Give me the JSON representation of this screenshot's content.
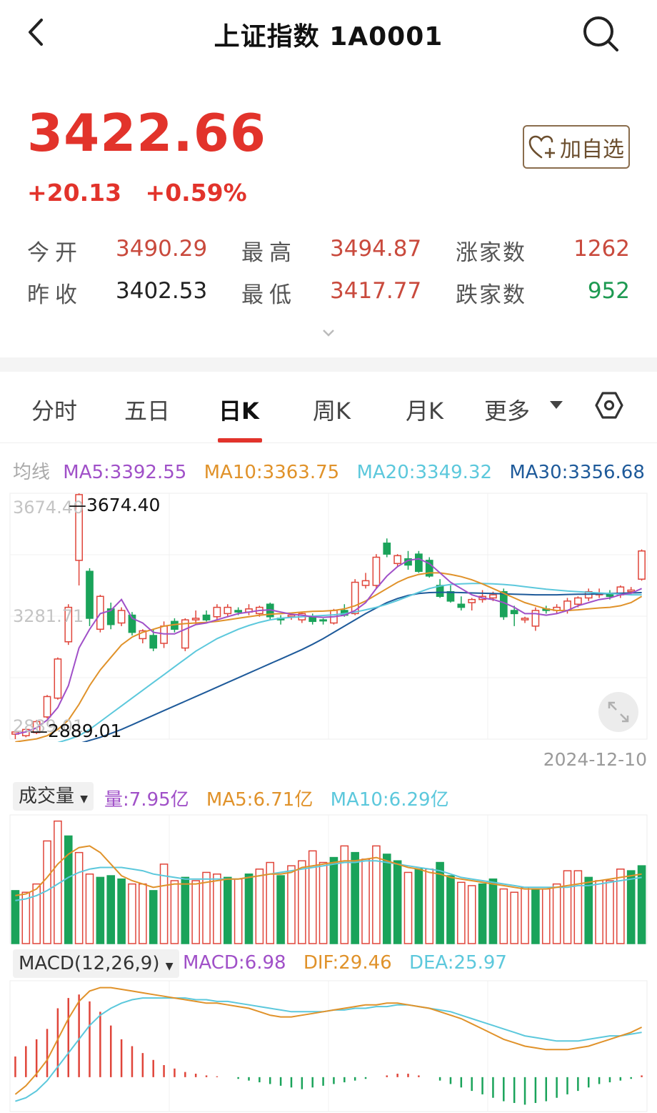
{
  "header": {
    "title": "上证指数 1A0001"
  },
  "quote": {
    "price": "3422.66",
    "change": "+20.13",
    "change_pct": "+0.59%",
    "fav_label": "加自选"
  },
  "stats": {
    "open_label": "今开",
    "open": "3490.29",
    "high_label": "最高",
    "high": "3494.87",
    "up_label": "涨家数",
    "up": "1262",
    "prev_close_label": "昨收",
    "prev_close": "3402.53",
    "low_label": "最低",
    "low": "3417.77",
    "down_label": "跌家数",
    "down": "952"
  },
  "tabs": [
    {
      "label": "分时"
    },
    {
      "label": "五日"
    },
    {
      "label": "日K"
    },
    {
      "label": "周K"
    },
    {
      "label": "月K"
    },
    {
      "label": "更多"
    }
  ],
  "ma_legend": {
    "title": "均线",
    "ma5": "MA5:3392.55",
    "ma10": "MA10:3363.75",
    "ma20": "MA20:3349.32",
    "ma30": "MA30:3356.68"
  },
  "kline": {
    "axis_top": "3674.40",
    "axis_mid": "3281.71",
    "axis_bottom": "2889.01",
    "max_marker": "3674.40",
    "min_marker": "2889.01",
    "end_date": "2024-12-10"
  },
  "volume": {
    "selector": "成交量",
    "vol": "量:7.95亿",
    "ma5": "MA5:6.71亿",
    "ma10": "MA10:6.29亿"
  },
  "macd": {
    "selector": "MACD(12,26,9)",
    "macd": "MACD:6.98",
    "dif": "DIF:29.46",
    "dea": "DEA:25.97"
  },
  "colors": {
    "up": "#e0453a",
    "down": "#1aa35a",
    "ma5": "#a050c8",
    "ma10": "#e0922a",
    "ma20": "#5cc8dc",
    "ma30": "#1e5a9a",
    "accent": "#e2332b"
  },
  "chart_data": [
    {
      "type": "candlestick",
      "title": "",
      "ylim": [
        2889.01,
        3674.4
      ],
      "y_ticks": [
        "3674.40",
        "3281.71",
        "2889.01"
      ],
      "x_end": "2024-12-10",
      "candles": [
        {
          "o": 2905,
          "h": 2915,
          "l": 2889,
          "c": 2912
        },
        {
          "o": 2900,
          "h": 2925,
          "l": 2895,
          "c": 2920
        },
        {
          "o": 2910,
          "h": 2950,
          "l": 2905,
          "c": 2945
        },
        {
          "o": 2960,
          "h": 3030,
          "l": 2955,
          "c": 3025
        },
        {
          "o": 3020,
          "h": 3150,
          "l": 3015,
          "c": 3145
        },
        {
          "o": 3200,
          "h": 3320,
          "l": 3190,
          "c": 3310
        },
        {
          "o": 3460,
          "h": 3674,
          "l": 3380,
          "c": 3670
        },
        {
          "o": 3425,
          "h": 3435,
          "l": 3250,
          "c": 3275
        },
        {
          "o": 3240,
          "h": 3350,
          "l": 3230,
          "c": 3345
        },
        {
          "o": 3305,
          "h": 3325,
          "l": 3240,
          "c": 3255
        },
        {
          "o": 3260,
          "h": 3310,
          "l": 3250,
          "c": 3300
        },
        {
          "o": 3285,
          "h": 3295,
          "l": 3220,
          "c": 3230
        },
        {
          "o": 3210,
          "h": 3240,
          "l": 3195,
          "c": 3235
        },
        {
          "o": 3220,
          "h": 3240,
          "l": 3170,
          "c": 3180
        },
        {
          "o": 3195,
          "h": 3265,
          "l": 3180,
          "c": 3250
        },
        {
          "o": 3265,
          "h": 3275,
          "l": 3230,
          "c": 3240
        },
        {
          "o": 3180,
          "h": 3275,
          "l": 3170,
          "c": 3270
        },
        {
          "o": 3270,
          "h": 3300,
          "l": 3255,
          "c": 3275
        },
        {
          "o": 3285,
          "h": 3300,
          "l": 3265,
          "c": 3270
        },
        {
          "o": 3280,
          "h": 3320,
          "l": 3270,
          "c": 3310
        },
        {
          "o": 3290,
          "h": 3320,
          "l": 3280,
          "c": 3310
        },
        {
          "o": 3300,
          "h": 3310,
          "l": 3285,
          "c": 3295
        },
        {
          "o": 3295,
          "h": 3320,
          "l": 3285,
          "c": 3305
        },
        {
          "o": 3290,
          "h": 3315,
          "l": 3280,
          "c": 3310
        },
        {
          "o": 3320,
          "h": 3325,
          "l": 3270,
          "c": 3280
        },
        {
          "o": 3275,
          "h": 3285,
          "l": 3255,
          "c": 3270
        },
        {
          "o": 3280,
          "h": 3290,
          "l": 3270,
          "c": 3285
        },
        {
          "o": 3270,
          "h": 3295,
          "l": 3260,
          "c": 3290
        },
        {
          "o": 3280,
          "h": 3290,
          "l": 3255,
          "c": 3265
        },
        {
          "o": 3270,
          "h": 3275,
          "l": 3255,
          "c": 3268
        },
        {
          "o": 3260,
          "h": 3305,
          "l": 3255,
          "c": 3300
        },
        {
          "o": 3300,
          "h": 3320,
          "l": 3280,
          "c": 3285
        },
        {
          "o": 3290,
          "h": 3400,
          "l": 3285,
          "c": 3390
        },
        {
          "o": 3380,
          "h": 3420,
          "l": 3370,
          "c": 3395
        },
        {
          "o": 3380,
          "h": 3480,
          "l": 3370,
          "c": 3470
        },
        {
          "o": 3515,
          "h": 3530,
          "l": 3470,
          "c": 3480
        },
        {
          "o": 3450,
          "h": 3480,
          "l": 3440,
          "c": 3475
        },
        {
          "o": 3465,
          "h": 3490,
          "l": 3430,
          "c": 3445
        },
        {
          "o": 3480,
          "h": 3490,
          "l": 3420,
          "c": 3425
        },
        {
          "o": 3460,
          "h": 3470,
          "l": 3405,
          "c": 3410
        },
        {
          "o": 3380,
          "h": 3400,
          "l": 3340,
          "c": 3345
        },
        {
          "o": 3360,
          "h": 3380,
          "l": 3325,
          "c": 3330
        },
        {
          "o": 3320,
          "h": 3345,
          "l": 3300,
          "c": 3310
        },
        {
          "o": 3325,
          "h": 3340,
          "l": 3300,
          "c": 3335
        },
        {
          "o": 3335,
          "h": 3365,
          "l": 3325,
          "c": 3345
        },
        {
          "o": 3340,
          "h": 3360,
          "l": 3330,
          "c": 3350
        },
        {
          "o": 3360,
          "h": 3370,
          "l": 3270,
          "c": 3280
        },
        {
          "o": 3300,
          "h": 3315,
          "l": 3250,
          "c": 3290
        },
        {
          "o": 3270,
          "h": 3280,
          "l": 3260,
          "c": 3275
        },
        {
          "o": 3250,
          "h": 3310,
          "l": 3235,
          "c": 3300
        },
        {
          "o": 3305,
          "h": 3315,
          "l": 3290,
          "c": 3300
        },
        {
          "o": 3300,
          "h": 3320,
          "l": 3290,
          "c": 3310
        },
        {
          "o": 3300,
          "h": 3340,
          "l": 3290,
          "c": 3330
        },
        {
          "o": 3320,
          "h": 3345,
          "l": 3310,
          "c": 3340
        },
        {
          "o": 3340,
          "h": 3370,
          "l": 3330,
          "c": 3360
        },
        {
          "o": 3350,
          "h": 3370,
          "l": 3340,
          "c": 3355
        },
        {
          "o": 3355,
          "h": 3365,
          "l": 3335,
          "c": 3345
        },
        {
          "o": 3350,
          "h": 3380,
          "l": 3340,
          "c": 3375
        },
        {
          "o": 3360,
          "h": 3375,
          "l": 3350,
          "c": 3365
        },
        {
          "o": 3400,
          "h": 3495,
          "l": 3395,
          "c": 3490
        }
      ],
      "ma5": [
        2905,
        2912,
        2925,
        2950,
        2990,
        3060,
        3180,
        3240,
        3290,
        3300,
        3335,
        3275,
        3260,
        3230,
        3225,
        3225,
        3240,
        3255,
        3260,
        3270,
        3280,
        3290,
        3295,
        3300,
        3302,
        3295,
        3288,
        3285,
        3280,
        3278,
        3280,
        3285,
        3300,
        3325,
        3370,
        3410,
        3440,
        3460,
        3465,
        3450,
        3420,
        3390,
        3370,
        3350,
        3340,
        3335,
        3325,
        3310,
        3290,
        3290,
        3285,
        3290,
        3300,
        3315,
        3325,
        3335,
        3340,
        3350,
        3355,
        3370
      ],
      "ma10": [
        2880,
        2885,
        2890,
        2900,
        2920,
        2950,
        3000,
        3060,
        3110,
        3150,
        3190,
        3215,
        3230,
        3240,
        3250,
        3255,
        3258,
        3260,
        3262,
        3265,
        3270,
        3275,
        3280,
        3285,
        3288,
        3290,
        3292,
        3295,
        3297,
        3298,
        3300,
        3305,
        3315,
        3330,
        3350,
        3370,
        3390,
        3405,
        3415,
        3420,
        3420,
        3415,
        3408,
        3398,
        3385,
        3370,
        3355,
        3340,
        3325,
        3315,
        3305,
        3300,
        3300,
        3302,
        3305,
        3308,
        3310,
        3315,
        3325,
        3345
      ],
      "ma20": [
        2860,
        2862,
        2865,
        2870,
        2878,
        2888,
        2900,
        2920,
        2945,
        2970,
        2995,
        3020,
        3045,
        3070,
        3095,
        3120,
        3145,
        3170,
        3190,
        3210,
        3225,
        3240,
        3252,
        3262,
        3270,
        3275,
        3278,
        3280,
        3282,
        3284,
        3286,
        3290,
        3295,
        3302,
        3310,
        3320,
        3332,
        3345,
        3358,
        3370,
        3378,
        3383,
        3385,
        3386,
        3386,
        3385,
        3383,
        3380,
        3376,
        3372,
        3368,
        3365,
        3362,
        3360,
        3358,
        3356,
        3354,
        3352,
        3350,
        3350
      ],
      "ma30": [
        2850,
        2852,
        2855,
        2858,
        2862,
        2868,
        2875,
        2885,
        2895,
        2907,
        2920,
        2935,
        2950,
        2965,
        2980,
        2995,
        3010,
        3025,
        3040,
        3055,
        3070,
        3085,
        3100,
        3115,
        3130,
        3145,
        3160,
        3175,
        3192,
        3210,
        3230,
        3250,
        3270,
        3290,
        3308,
        3325,
        3338,
        3348,
        3354,
        3357,
        3358,
        3358,
        3357,
        3356,
        3355,
        3354,
        3353,
        3352,
        3351,
        3350,
        3350,
        3350,
        3351,
        3352,
        3352,
        3353,
        3354,
        3355,
        3356,
        3357
      ]
    },
    {
      "type": "bar",
      "title": "",
      "bars": [
        {
          "v": 3.2,
          "up": false
        },
        {
          "v": 3.1,
          "up": true
        },
        {
          "v": 3.6,
          "up": true
        },
        {
          "v": 6.2,
          "up": true
        },
        {
          "v": 7.4,
          "up": true
        },
        {
          "v": 6.5,
          "up": false
        },
        {
          "v": 5.5,
          "up": true
        },
        {
          "v": 4.2,
          "up": true
        },
        {
          "v": 4.0,
          "up": false
        },
        {
          "v": 4.1,
          "up": false
        },
        {
          "v": 3.9,
          "up": false
        },
        {
          "v": 3.6,
          "up": true
        },
        {
          "v": 3.6,
          "up": true
        },
        {
          "v": 3.2,
          "up": false
        },
        {
          "v": 4.8,
          "up": true
        },
        {
          "v": 3.8,
          "up": true
        },
        {
          "v": 4.0,
          "up": false
        },
        {
          "v": 3.8,
          "up": true
        },
        {
          "v": 4.3,
          "up": true
        },
        {
          "v": 4.2,
          "up": true
        },
        {
          "v": 4.0,
          "up": false
        },
        {
          "v": 3.9,
          "up": true
        },
        {
          "v": 4.2,
          "up": false
        },
        {
          "v": 4.5,
          "up": true
        },
        {
          "v": 4.9,
          "up": true
        },
        {
          "v": 4.1,
          "up": false
        },
        {
          "v": 4.7,
          "up": true
        },
        {
          "v": 5.0,
          "up": true
        },
        {
          "v": 5.6,
          "up": true
        },
        {
          "v": 4.9,
          "up": true
        },
        {
          "v": 5.2,
          "up": false
        },
        {
          "v": 5.9,
          "up": true
        },
        {
          "v": 5.5,
          "up": false
        },
        {
          "v": 5.1,
          "up": true
        },
        {
          "v": 5.9,
          "up": true
        },
        {
          "v": 5.4,
          "up": false
        },
        {
          "v": 5.0,
          "up": false
        },
        {
          "v": 4.3,
          "up": true
        },
        {
          "v": 4.5,
          "up": false
        },
        {
          "v": 4.5,
          "up": true
        },
        {
          "v": 4.9,
          "up": false
        },
        {
          "v": 4.1,
          "up": false
        },
        {
          "v": 3.7,
          "up": true
        },
        {
          "v": 3.5,
          "up": true
        },
        {
          "v": 3.6,
          "up": false
        },
        {
          "v": 3.9,
          "up": false
        },
        {
          "v": 3.3,
          "up": true
        },
        {
          "v": 3.1,
          "up": true
        },
        {
          "v": 3.4,
          "up": true
        },
        {
          "v": 3.3,
          "up": false
        },
        {
          "v": 3.3,
          "up": true
        },
        {
          "v": 3.6,
          "up": true
        },
        {
          "v": 4.4,
          "up": true
        },
        {
          "v": 4.4,
          "up": true
        },
        {
          "v": 4.0,
          "up": false
        },
        {
          "v": 3.8,
          "up": true
        },
        {
          "v": 3.8,
          "up": true
        },
        {
          "v": 4.5,
          "up": true
        },
        {
          "v": 4.4,
          "up": false
        },
        {
          "v": 4.7,
          "up": false
        }
      ],
      "ma5": [
        2.9,
        3.0,
        3.3,
        4.0,
        4.8,
        5.4,
        5.8,
        5.9,
        5.5,
        4.8,
        4.1,
        3.8,
        3.6,
        3.4,
        3.5,
        3.6,
        3.6,
        3.6,
        3.7,
        3.8,
        3.9,
        3.9,
        4.0,
        4.1,
        4.2,
        4.2,
        4.3,
        4.6,
        4.7,
        4.8,
        4.9,
        5.0,
        5.0,
        5.1,
        5.2,
        5.0,
        4.8,
        4.6,
        4.5,
        4.3,
        4.2,
        4.0,
        3.9,
        3.8,
        3.7,
        3.6,
        3.5,
        3.4,
        3.3,
        3.3,
        3.3,
        3.4,
        3.5,
        3.6,
        3.7,
        3.8,
        3.9,
        4.0,
        4.1,
        4.2
      ],
      "ma10": [
        2.6,
        2.7,
        2.9,
        3.2,
        3.6,
        4.0,
        4.3,
        4.5,
        4.6,
        4.6,
        4.6,
        4.5,
        4.4,
        4.2,
        4.1,
        4.0,
        3.9,
        3.9,
        3.9,
        3.9,
        3.9,
        3.9,
        4.0,
        4.1,
        4.2,
        4.3,
        4.4,
        4.5,
        4.6,
        4.7,
        4.8,
        4.9,
        4.9,
        5.0,
        5.0,
        4.9,
        4.8,
        4.7,
        4.6,
        4.5,
        4.4,
        4.2,
        4.0,
        3.9,
        3.8,
        3.7,
        3.6,
        3.5,
        3.4,
        3.4,
        3.4,
        3.4,
        3.4,
        3.5,
        3.5,
        3.6,
        3.7,
        3.8,
        3.9,
        4.0
      ]
    },
    {
      "type": "bar",
      "title": "",
      "macd_hist": [
        12,
        18,
        22,
        28,
        40,
        46,
        48,
        44,
        38,
        30,
        22,
        18,
        14,
        10,
        7,
        5,
        3,
        2,
        1,
        0.5,
        0,
        -1,
        -2,
        -3,
        -4,
        -5,
        -6,
        -7,
        -6,
        -5,
        -4,
        -3,
        -2,
        -1,
        0,
        1,
        2,
        2,
        1,
        0,
        -2,
        -4,
        -6,
        -8,
        -10,
        -12,
        -14,
        -15,
        -16,
        -15,
        -14,
        -12,
        -10,
        -8,
        -6,
        -4,
        -3,
        -2,
        -1,
        1
      ],
      "dif": [
        -10,
        -5,
        2,
        10,
        22,
        34,
        44,
        50,
        52,
        52,
        51,
        50,
        49,
        48,
        47,
        46,
        45,
        44,
        43,
        43,
        42,
        41,
        40,
        38,
        36,
        35,
        35,
        36,
        37,
        38,
        39,
        40,
        41,
        42,
        42,
        43,
        43,
        42,
        41,
        40,
        38,
        36,
        34,
        31,
        28,
        25,
        22,
        20,
        18,
        17,
        16,
        16,
        16,
        17,
        18,
        20,
        22,
        24,
        26,
        29
      ],
      "dea": [
        -14,
        -12,
        -8,
        -2,
        6,
        14,
        22,
        30,
        36,
        40,
        43,
        45,
        46,
        46,
        46,
        46,
        46,
        45,
        45,
        44,
        44,
        43,
        42,
        41,
        40,
        39,
        38,
        38,
        38,
        38,
        39,
        39,
        40,
        40,
        41,
        41,
        42,
        42,
        41,
        40,
        39,
        38,
        36,
        34,
        32,
        30,
        28,
        26,
        24,
        23,
        22,
        21,
        21,
        21,
        22,
        23,
        24,
        24,
        25,
        26
      ]
    }
  ]
}
